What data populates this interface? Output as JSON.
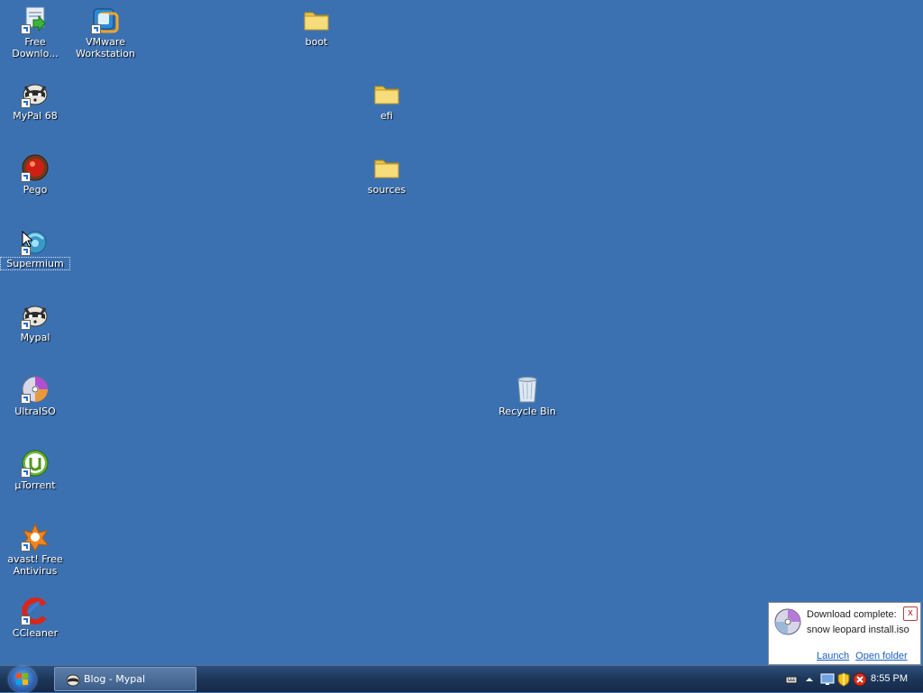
{
  "desktop": {
    "icons": {
      "free_download_manager": {
        "label": "Free Downlo..."
      },
      "vmware_workstation": {
        "label": "VMware Workstation"
      },
      "boot": {
        "label": "boot"
      },
      "mypal68": {
        "label": "MyPal 68"
      },
      "efi": {
        "label": "efi"
      },
      "pego": {
        "label": "Pego"
      },
      "sources": {
        "label": "sources"
      },
      "supermium": {
        "label": "Supermium"
      },
      "mypal": {
        "label": "Mypal"
      },
      "ultraiso": {
        "label": "UltraISO"
      },
      "recycle_bin": {
        "label": "Recycle Bin"
      },
      "utorrent": {
        "label": "µTorrent"
      },
      "avast": {
        "label": "avast! Free Antivirus"
      },
      "ccleaner": {
        "label": "CCleaner"
      }
    }
  },
  "notification": {
    "line1": "Download complete:",
    "line2": "snow leopard install.iso",
    "launch": "Launch",
    "open_folder": "Open folder",
    "close_glyph": "x"
  },
  "taskbar": {
    "window_title": "Blog - Mypal",
    "clock": "8:55 PM"
  },
  "colors": {
    "desktop": "#3c71b1",
    "link": "#1a5fc4"
  }
}
